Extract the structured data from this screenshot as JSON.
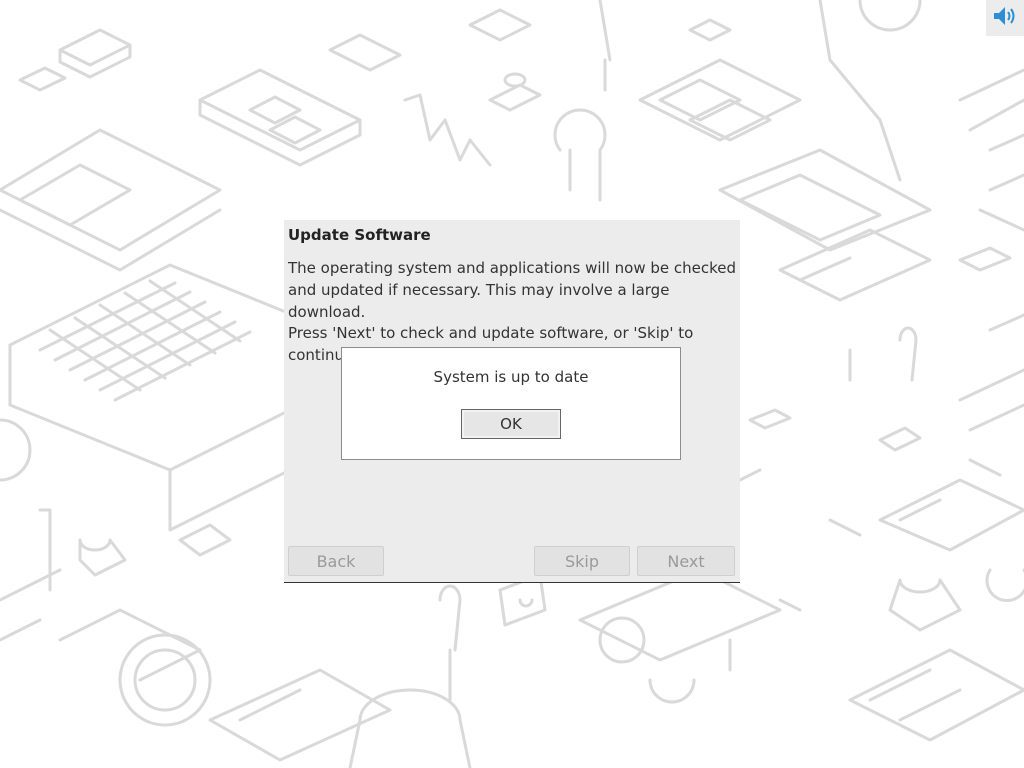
{
  "wizard": {
    "title": "Update Software",
    "paragraph1": "The operating system and applications will now be checked and updated if necessary. This may involve a large download.",
    "paragraph2": "Press 'Next' to check and update software, or 'Skip' to continue without",
    "buttons": {
      "back": "Back",
      "skip": "Skip",
      "next": "Next"
    }
  },
  "message_box": {
    "text": "System is up to date",
    "ok": "OK"
  },
  "tray": {
    "icon": "volume-icon"
  }
}
